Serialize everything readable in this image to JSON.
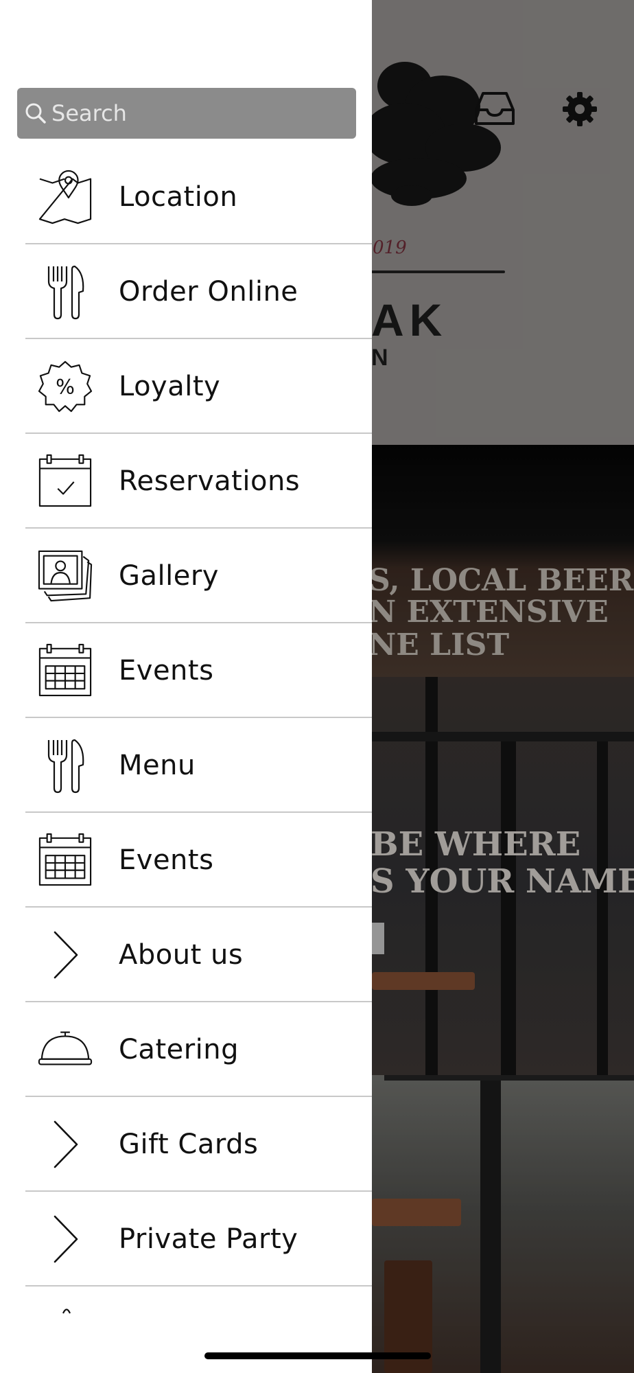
{
  "search": {
    "placeholder": "Search",
    "icon": "search-icon"
  },
  "menu_items": [
    {
      "label": "Location",
      "icon": "map-pin-icon"
    },
    {
      "label": "Order Online",
      "icon": "fork-knife-icon"
    },
    {
      "label": "Loyalty",
      "icon": "percent-badge-icon"
    },
    {
      "label": "Reservations",
      "icon": "calendar-check-icon"
    },
    {
      "label": "Gallery",
      "icon": "photo-stack-icon"
    },
    {
      "label": "Events",
      "icon": "calendar-grid-icon"
    },
    {
      "label": "Menu",
      "icon": "fork-knife-icon"
    },
    {
      "label": "Events",
      "icon": "calendar-grid-icon"
    },
    {
      "label": "About us",
      "icon": "chevron-right-icon"
    },
    {
      "label": "Catering",
      "icon": "serving-cloche-icon"
    },
    {
      "label": "Gift Cards",
      "icon": "chevron-right-icon"
    },
    {
      "label": "Private Party",
      "icon": "chevron-right-icon"
    }
  ],
  "background": {
    "hero": {
      "year_text": "019",
      "title_partial": "AK",
      "subtitle_partial": "N"
    },
    "header_icons": [
      "inbox-icon",
      "gear-icon"
    ],
    "banner1_lines": [
      "S, LOCAL BEERS",
      "N EXTENSIVE",
      "NE LIST"
    ],
    "banner2_lines": [
      "BE WHERE",
      "S YOUR NAME"
    ]
  },
  "colors": {
    "drawer_bg": "#ffffff",
    "search_bg": "#8b8b8b",
    "separator": "#c8c8c8",
    "text": "#111111"
  }
}
